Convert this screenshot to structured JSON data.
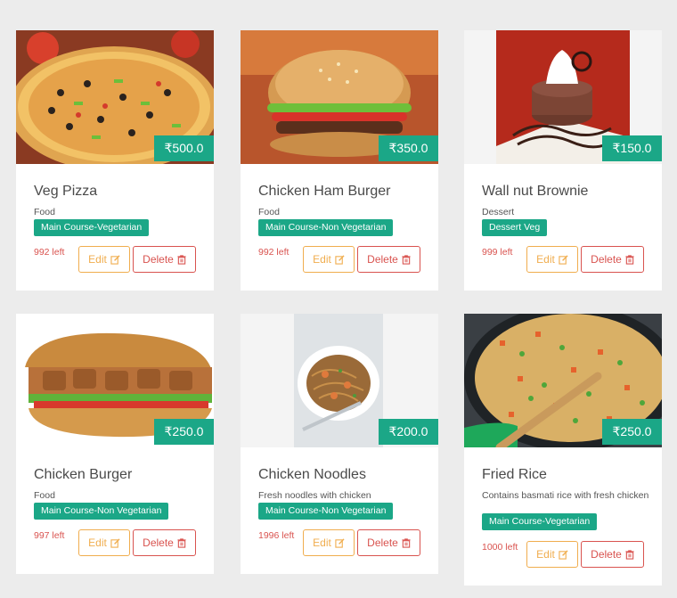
{
  "items": [
    {
      "name": "Veg Pizza",
      "description": "Food",
      "category": "Main Course-Vegetarian",
      "price": "₹500.0",
      "stock": "992 left",
      "edit_label": "Edit",
      "delete_label": "Delete",
      "image": "pizza"
    },
    {
      "name": "Chicken Ham Burger",
      "description": "Food",
      "category": "Main Course-Non Vegetarian",
      "price": "₹350.0",
      "stock": "992 left",
      "edit_label": "Edit",
      "delete_label": "Delete",
      "image": "burger"
    },
    {
      "name": "Wall nut Brownie",
      "description": "Dessert",
      "category": "Dessert Veg",
      "price": "₹150.0",
      "stock": "999 left",
      "edit_label": "Edit",
      "delete_label": "Delete",
      "image": "brownie"
    },
    {
      "name": "Chicken Burger",
      "description": "Food",
      "category": "Main Course-Non Vegetarian",
      "price": "₹250.0",
      "stock": "997 left",
      "edit_label": "Edit",
      "delete_label": "Delete",
      "image": "sub-sandwich"
    },
    {
      "name": "Chicken Noodles",
      "description": "Fresh noodles with chicken",
      "category": "Main Course-Non Vegetarian",
      "price": "₹200.0",
      "stock": "1996 left",
      "edit_label": "Edit",
      "delete_label": "Delete",
      "image": "noodles"
    },
    {
      "name": "Fried Rice",
      "description": "Contains basmati rice with fresh chicken",
      "category": "Main Course-Vegetarian",
      "price": "₹250.0",
      "stock": "1000 left",
      "edit_label": "Edit",
      "delete_label": "Delete",
      "image": "fried-rice"
    }
  ],
  "icons": {
    "edit": "edit-icon",
    "delete": "trash-icon"
  },
  "colors": {
    "accent": "#1ba787",
    "edit": "#f0ad4e",
    "delete": "#d9534f",
    "stock": "#d9534f"
  }
}
